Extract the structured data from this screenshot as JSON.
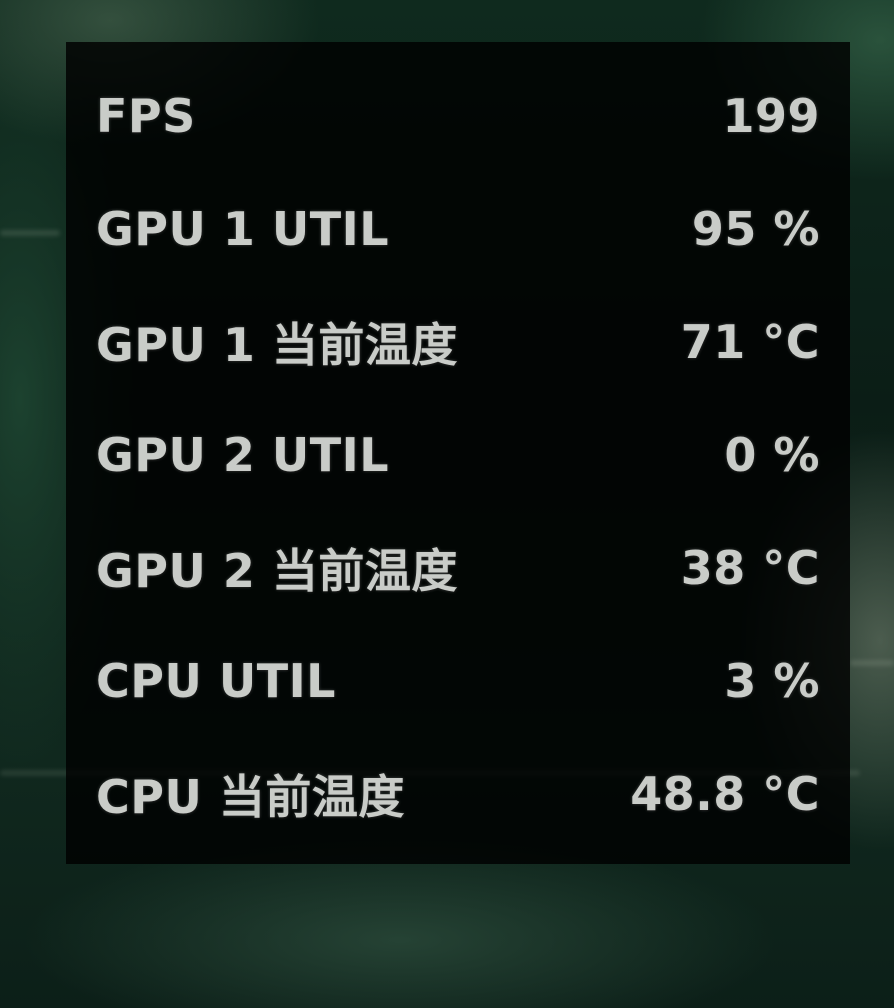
{
  "overlay": {
    "rows": [
      {
        "label": "FPS",
        "value": "199"
      },
      {
        "label": "GPU 1 UTIL",
        "value": "95 %"
      },
      {
        "label": "GPU 1 当前温度",
        "value": "71 °C"
      },
      {
        "label": "GPU 2 UTIL",
        "value": "0 %"
      },
      {
        "label": "GPU 2 当前温度",
        "value": "38 °C"
      },
      {
        "label": "CPU UTIL",
        "value": "3 %"
      },
      {
        "label": "CPU 当前温度",
        "value": "48.8 °C"
      }
    ]
  },
  "colors": {
    "text": "#c9ccc8",
    "panel": "#000000"
  }
}
